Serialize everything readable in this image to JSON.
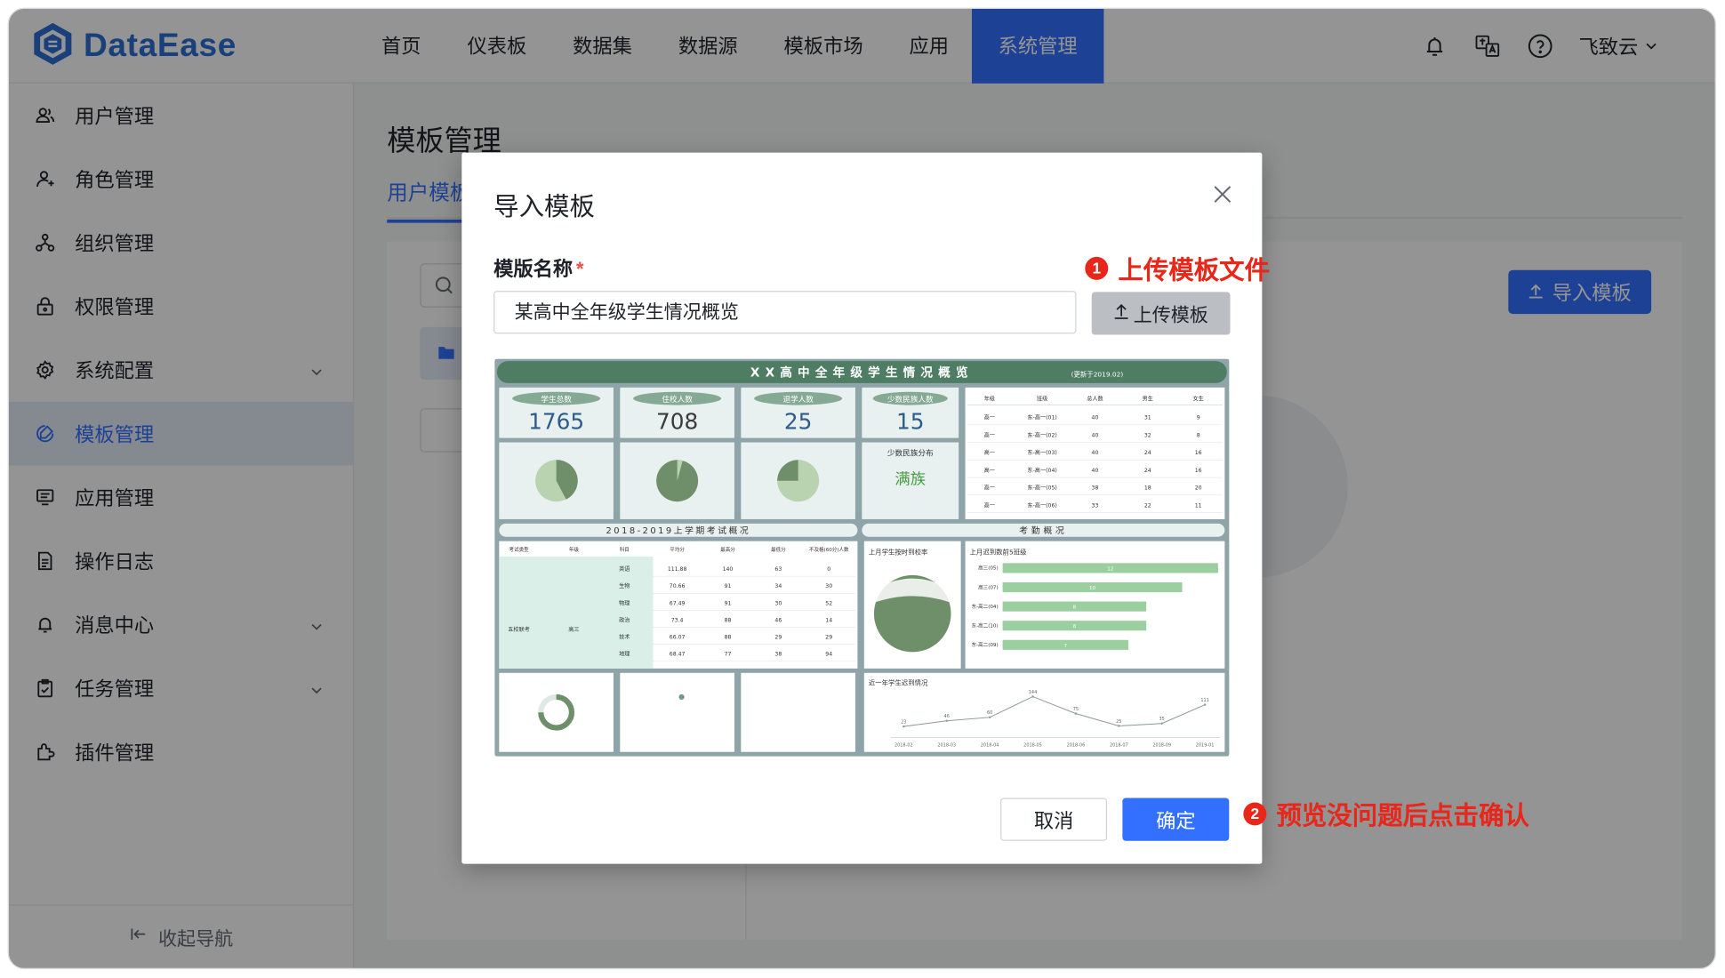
{
  "app": {
    "name": "DataEase"
  },
  "nav": {
    "items": [
      {
        "label": "首页"
      },
      {
        "label": "仪表板"
      },
      {
        "label": "数据集"
      },
      {
        "label": "数据源"
      },
      {
        "label": "模板市场"
      },
      {
        "label": "应用"
      },
      {
        "label": "系统管理"
      }
    ],
    "active": "系统管理"
  },
  "header": {
    "user_name": "飞致云"
  },
  "sidebar": {
    "items": [
      {
        "label": "用户管理",
        "icon": "users-icon"
      },
      {
        "label": "角色管理",
        "icon": "role-icon"
      },
      {
        "label": "组织管理",
        "icon": "org-icon"
      },
      {
        "label": "权限管理",
        "icon": "lock-icon"
      },
      {
        "label": "系统配置",
        "icon": "gear-icon",
        "expandable": true
      },
      {
        "label": "模板管理",
        "icon": "template-icon",
        "active": true
      },
      {
        "label": "应用管理",
        "icon": "app-icon"
      },
      {
        "label": "操作日志",
        "icon": "log-icon"
      },
      {
        "label": "消息中心",
        "icon": "bell-icon",
        "expandable": true
      },
      {
        "label": "任务管理",
        "icon": "task-icon",
        "expandable": true
      },
      {
        "label": "插件管理",
        "icon": "plugin-icon"
      }
    ],
    "collapse_label": "收起导航"
  },
  "main": {
    "title": "模板管理",
    "tab_label": "用户模板",
    "import_button": "导入模板"
  },
  "dialog": {
    "title": "导入模板",
    "name_label": "模版名称",
    "required_mark": "*",
    "name_value": "某高中全年级学生情况概览",
    "upload_button": "上传模板",
    "cancel_button": "取消",
    "confirm_button": "确定"
  },
  "annotations": {
    "step1_num": "1",
    "step1_text": "上传模板文件",
    "step2_num": "2",
    "step2_text": "预览没问题后点击确认"
  },
  "preview": {
    "title": "XX高中全年级学生情况概览",
    "updated": "(更新于2019.02)",
    "kpis": [
      {
        "label": "学生总数",
        "value": "1765"
      },
      {
        "label": "住校人数",
        "value": "708"
      },
      {
        "label": "退学人数",
        "value": "25"
      },
      {
        "label": "少数民族人数",
        "value": "15"
      }
    ],
    "minority_title": "少数民族分布",
    "minority_top": "满族",
    "exam_section": "2018-2019上学期考试概况",
    "attendance_section": "考勤概况",
    "attendance_rate_title": "上月学生按时到校率",
    "late_title": "上月迟到数前5班级",
    "late_trend_title": "近一年学生迟到情况",
    "class_table": {
      "headers": [
        "年级",
        "班级",
        "总人数",
        "男生",
        "女生"
      ],
      "rows": [
        [
          "高一",
          "东-高一(01)",
          "40",
          "31",
          "9"
        ],
        [
          "高一",
          "东-高一(02)",
          "40",
          "32",
          "8"
        ],
        [
          "高一",
          "东-高一(03)",
          "40",
          "24",
          "16"
        ],
        [
          "高一",
          "东-高一(04)",
          "40",
          "24",
          "16"
        ],
        [
          "高一",
          "东-高一(05)",
          "38",
          "18",
          "20"
        ],
        [
          "高一",
          "东-高一(06)",
          "33",
          "22",
          "11"
        ]
      ]
    },
    "exam_table": {
      "headers": [
        "考试类型",
        "年级",
        "科目",
        "平均分",
        "最高分",
        "最低分",
        "不及格(60分)人数"
      ],
      "exam_type": "五校联考",
      "grade": "高三",
      "rows": [
        [
          "英语",
          "111.88",
          "140",
          "63",
          "0"
        ],
        [
          "生物",
          "70.66",
          "91",
          "34",
          "30"
        ],
        [
          "物理",
          "67.49",
          "91",
          "30",
          "52"
        ],
        [
          "政治",
          "73.4",
          "88",
          "46",
          "14"
        ],
        [
          "技术",
          "66.07",
          "88",
          "29",
          "29"
        ],
        [
          "地理",
          "68.47",
          "77",
          "38",
          "94"
        ]
      ]
    },
    "late_bars": [
      {
        "label": "高三(05)",
        "value": 12
      },
      {
        "label": "高三(07)",
        "value": 10
      },
      {
        "label": "东-高二(04)",
        "value": 8
      },
      {
        "label": "东-高二(10)",
        "value": 8
      },
      {
        "label": "东-高二(09)",
        "value": 7
      }
    ],
    "late_trend": {
      "x": [
        "2018-02",
        "2018-03",
        "2018-04",
        "2018-05",
        "2018-06",
        "2018-07",
        "2018-09",
        "2019-01"
      ],
      "y": [
        23,
        46,
        60,
        144,
        75,
        25,
        35,
        111
      ]
    },
    "colors": {
      "header_green": "#4e7d64",
      "panel": "#e8f1ef",
      "bar_green": "#9ccf9f",
      "pie_dark": "#6f8f6a",
      "pie_light": "#b9d2b0"
    }
  }
}
